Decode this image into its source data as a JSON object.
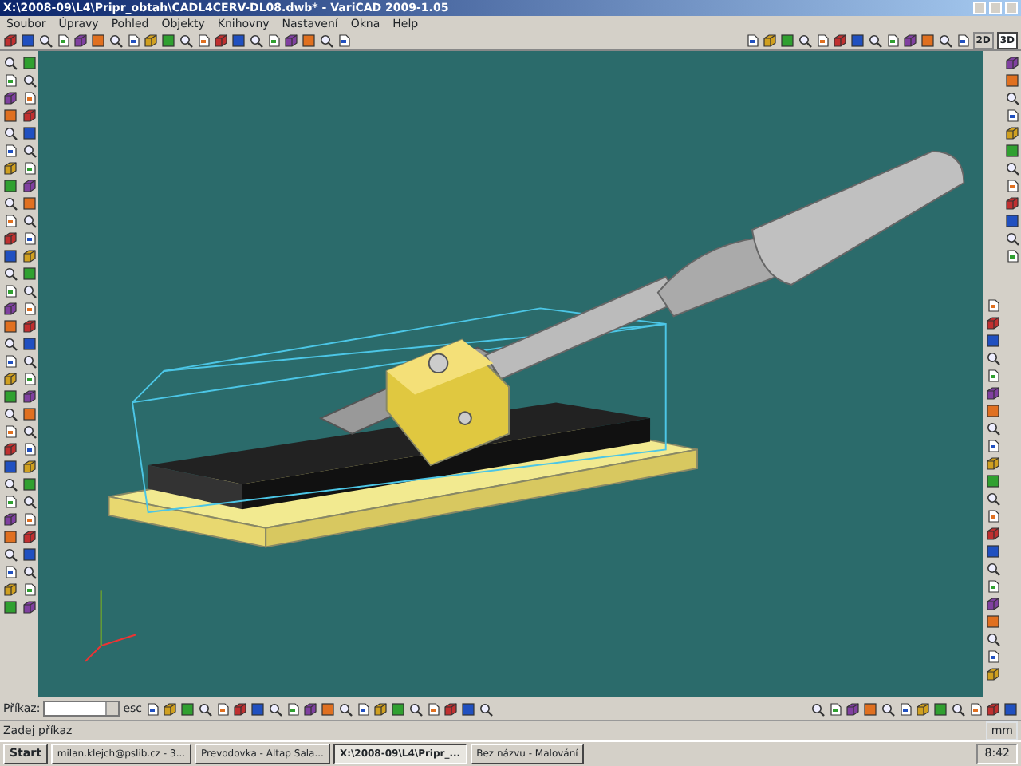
{
  "window": {
    "title": "X:\\2008-09\\L4\\Pripr_obtah\\CADL4CERV-DL08.dwb* - VariCAD 2009-1.05"
  },
  "menu": [
    {
      "label": "Soubor"
    },
    {
      "label": "Úpravy"
    },
    {
      "label": "Pohled"
    },
    {
      "label": "Objekty"
    },
    {
      "label": "Knihovny"
    },
    {
      "label": "Nastavení"
    },
    {
      "label": "Okna"
    },
    {
      "label": "Help"
    }
  ],
  "view_modes": [
    {
      "label": "2D",
      "selected": false
    },
    {
      "label": "3D",
      "selected": true
    }
  ],
  "command_bar": {
    "label": "Příkaz:",
    "escape": "esc"
  },
  "status_bar": {
    "prompt": "Zadej příkaz",
    "units": "mm"
  },
  "taskbar": {
    "start": "Start",
    "tasks": [
      {
        "label": "milan.klejch@pslib.cz - 3...",
        "selected": false
      },
      {
        "label": "Prevodovka - Altap Sala...",
        "selected": false
      },
      {
        "label": "X:\\2008-09\\L4\\Pripr_...",
        "selected": true
      },
      {
        "label": "Bez názvu - Malování",
        "selected": false
      }
    ],
    "clock": "8:42"
  }
}
